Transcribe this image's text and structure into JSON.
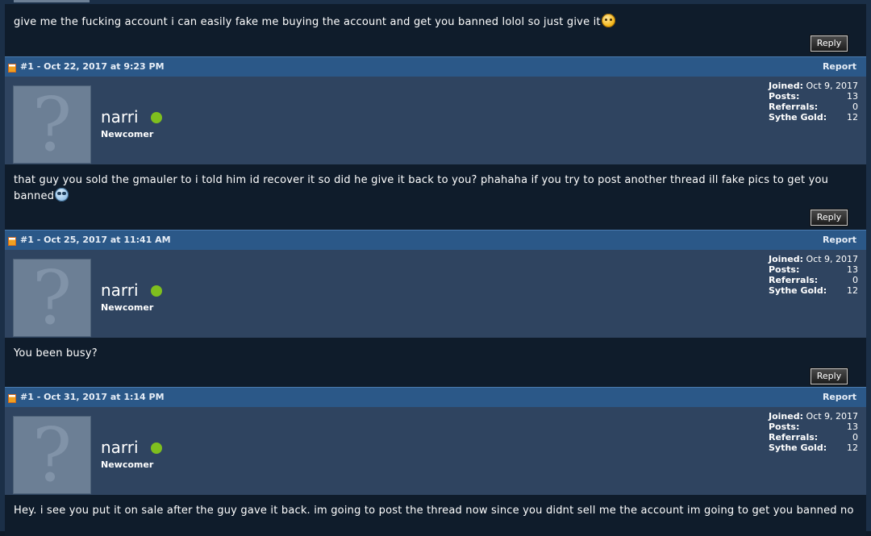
{
  "posts": [
    {
      "message_before": "give me the fucking account i can easily fake me buying the account and get you banned lolol so just give it",
      "emoji": "smile-emoji",
      "reply_label": "Reply"
    },
    {
      "header": "#1 - Oct 22, 2017 at 9:23 PM",
      "report_label": "Report",
      "username": "narri",
      "rank": "Newcomer",
      "stats": {
        "joined_label": "Joined:",
        "joined": "Oct 9, 2017",
        "posts_label": "Posts:",
        "posts": "13",
        "referrals_label": "Referrals:",
        "referrals": "0",
        "gold_label": "Sythe Gold:",
        "gold": "12"
      },
      "message": "that guy you sold the gmauler to i told him id recover it so did he give it back to you? phahaha if you try to post another thread ill fake pics to get you banned",
      "emoji": "nerd-emoji",
      "reply_label": "Reply"
    },
    {
      "header": "#1 - Oct 25, 2017 at 11:41 AM",
      "report_label": "Report",
      "username": "narri",
      "rank": "Newcomer",
      "stats": {
        "joined_label": "Joined:",
        "joined": "Oct 9, 2017",
        "posts_label": "Posts:",
        "posts": "13",
        "referrals_label": "Referrals:",
        "referrals": "0",
        "gold_label": "Sythe Gold:",
        "gold": "12"
      },
      "message": "You been busy?",
      "reply_label": "Reply"
    },
    {
      "header": "#1 - Oct 31, 2017 at 1:14 PM",
      "report_label": "Report",
      "username": "narri",
      "rank": "Newcomer",
      "stats": {
        "joined_label": "Joined:",
        "joined": "Oct 9, 2017",
        "posts_label": "Posts:",
        "posts": "13",
        "referrals_label": "Referrals:",
        "referrals": "0",
        "gold_label": "Sythe Gold:",
        "gold": "12"
      },
      "message": "Hey. i see you put it on sale after the guy gave it back. im going to post the thread now since you didnt sell me the account im going to get you banned no"
    }
  ],
  "colors": {
    "header_bar": "#2b5888",
    "user_bar": "#2f4460",
    "message_bg": "#0f1c2b",
    "online": "#7fbf1e"
  }
}
